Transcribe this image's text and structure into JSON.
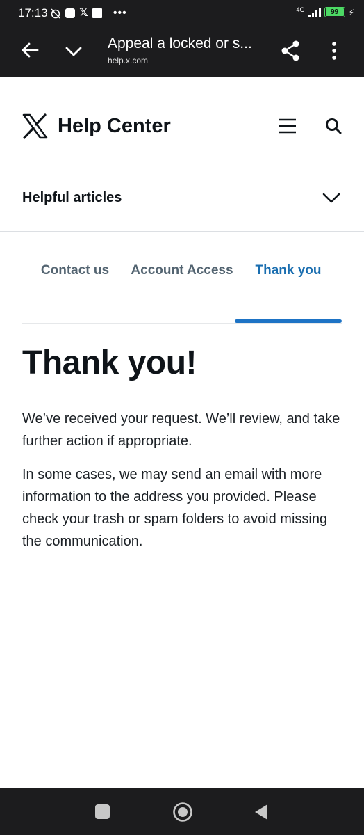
{
  "status_bar": {
    "time": "17:13",
    "network": "4G",
    "battery": "99"
  },
  "browser": {
    "title": "Appeal a locked or s...",
    "url": "help.x.com"
  },
  "header": {
    "brand": "Help Center"
  },
  "helpful": {
    "label": "Helpful articles"
  },
  "steps": [
    {
      "label": "Contact us",
      "active": false
    },
    {
      "label": "Account Access",
      "active": false
    },
    {
      "label": "Thank you",
      "active": true
    }
  ],
  "content": {
    "title": "Thank you!",
    "paragraph1": "We’ve received your request. We’ll review, and take further action if appropriate.",
    "paragraph2": "In some cases, we may send an email with more information to the address you provided. Please check your trash or spam folders to avoid missing the communication."
  },
  "colors": {
    "active_tab": "#1a6eb0",
    "active_underline": "#1d73c5",
    "inactive_tab": "#536471",
    "system_bar": "#1c1c1e"
  },
  "icons": [
    "back-arrow-icon",
    "chevron-down-icon",
    "share-icon",
    "more-vert-icon",
    "x-logo-icon",
    "menu-icon",
    "search-icon",
    "recents-icon",
    "home-icon",
    "nav-back-icon"
  ]
}
